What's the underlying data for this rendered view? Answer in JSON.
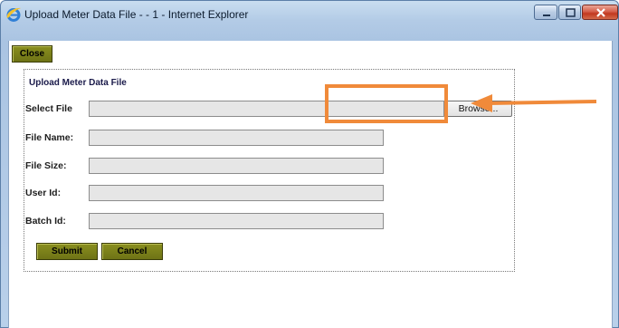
{
  "window": {
    "title": "Upload Meter Data File - - 1 - Internet Explorer",
    "icon": "ie-icon",
    "controls": [
      "minimize-icon",
      "maximize-icon",
      "close-icon"
    ]
  },
  "toolbar": {
    "close_label": "Close"
  },
  "form": {
    "title": "Upload Meter Data File",
    "select_file_label": "Select File",
    "browse_label": "Browse...",
    "file_name_label": "File Name:",
    "file_size_label": "File Size:",
    "user_id_label": "User Id:",
    "batch_id_label": "Batch Id:",
    "submit_label": "Submit",
    "cancel_label": "Cancel"
  },
  "colors": {
    "button_olive": "#6e7316",
    "annotation_orange": "#f08a3a",
    "field_gray": "#e6e6e6"
  }
}
